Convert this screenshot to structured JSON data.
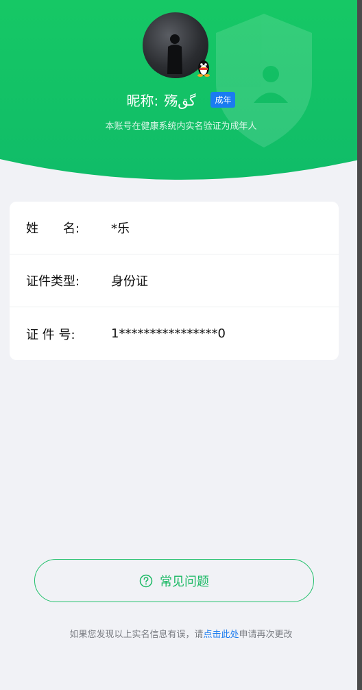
{
  "header": {
    "nickname_label": "昵称:",
    "nickname_value": "殇گق",
    "age_badge": "成年",
    "subtitle": "本账号在健康系统内实名验证为成年人",
    "colors": {
      "green_top": "#17c764",
      "green_bottom": "#12c06a"
    }
  },
  "identity": {
    "rows": [
      {
        "label": "姓　　名:",
        "value": "*乐"
      },
      {
        "label": "证件类型:",
        "value": "身份证"
      },
      {
        "label": "证 件 号:",
        "value": "1****************0"
      }
    ]
  },
  "faq": {
    "label": "常见问题",
    "icon": "question-circle-icon"
  },
  "footer": {
    "prefix": "如果您发现以上实名信息有误，请",
    "link": "点击此处",
    "suffix": "申请再次更改"
  }
}
